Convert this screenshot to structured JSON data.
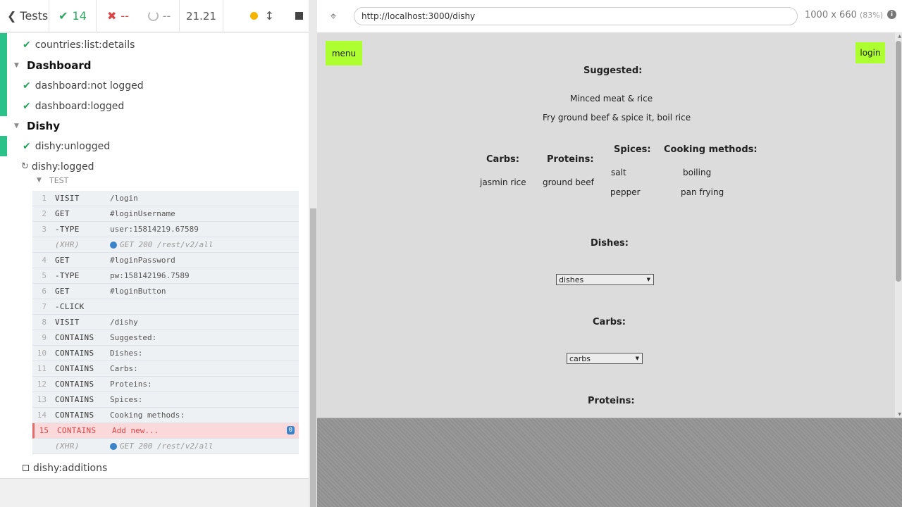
{
  "header": {
    "tests_label": "Tests",
    "passed_count": "14",
    "failed_count": "--",
    "pending_count": "--",
    "duration": "21.21"
  },
  "tests": {
    "row_countries": "countries:list:details",
    "suite_dashboard": "Dashboard",
    "row_dash_not": "dashboard:not logged",
    "row_dash_logged": "dashboard:logged",
    "suite_dishy": "Dishy",
    "row_dishy_unlogged": "dishy:unlogged",
    "row_dishy_logged": "dishy:logged",
    "test_section": "TEST",
    "row_dishy_additions": "dishy:additions"
  },
  "commands": [
    {
      "num": "1",
      "name": "VISIT",
      "msg": "/login"
    },
    {
      "num": "2",
      "name": "GET",
      "msg": "#loginUsername"
    },
    {
      "num": "3",
      "name": "-TYPE",
      "msg": "user:15814219.67589"
    },
    {
      "num": "",
      "name": "(XHR)",
      "msg": "GET 200 /rest/v2/all"
    },
    {
      "num": "4",
      "name": "GET",
      "msg": "#loginPassword"
    },
    {
      "num": "5",
      "name": "-TYPE",
      "msg": "pw:158142196.7589"
    },
    {
      "num": "6",
      "name": "GET",
      "msg": "#loginButton"
    },
    {
      "num": "7",
      "name": "-CLICK",
      "msg": ""
    },
    {
      "num": "8",
      "name": "VISIT",
      "msg": "/dishy"
    },
    {
      "num": "9",
      "name": "CONTAINS",
      "msg": "Suggested:"
    },
    {
      "num": "10",
      "name": "CONTAINS",
      "msg": "Dishes:"
    },
    {
      "num": "11",
      "name": "CONTAINS",
      "msg": "Carbs:"
    },
    {
      "num": "12",
      "name": "CONTAINS",
      "msg": "Proteins:"
    },
    {
      "num": "13",
      "name": "CONTAINS",
      "msg": "Spices:"
    },
    {
      "num": "14",
      "name": "CONTAINS",
      "msg": "Cooking methods:"
    },
    {
      "num": "15",
      "name": "CONTAINS",
      "msg": "Add new..."
    },
    {
      "num": "",
      "name": "(XHR)",
      "msg": "GET 200 /rest/v2/all"
    }
  ],
  "fail_badge": "0",
  "aut": {
    "url": "http://localhost:3000/dishy",
    "viewport": "1000 x 660",
    "viewport_pct": "(83%)"
  },
  "page": {
    "menu": "menu",
    "login": "login",
    "suggested_title": "Suggested:",
    "suggested_name": "Minced meat & rice",
    "suggested_desc": "Fry ground beef & spice it, boil rice",
    "carbs_title": "Carbs:",
    "carbs_item": "jasmin rice",
    "proteins_title": "Proteins:",
    "proteins_item": "ground beef",
    "spices_title": "Spices:",
    "spice_1": "salt",
    "spice_2": "pepper",
    "methods_title": "Cooking methods:",
    "method_1": "boiling",
    "method_2": "pan frying",
    "dishes_heading": "Dishes:",
    "dishes_select": "dishes",
    "carbs_heading": "Carbs:",
    "carbs_select": "carbs",
    "proteins_heading": "Proteins:"
  },
  "colors": {
    "pass": "#2bc28a",
    "fail": "#dd4444",
    "green_button": "#adff2f"
  }
}
